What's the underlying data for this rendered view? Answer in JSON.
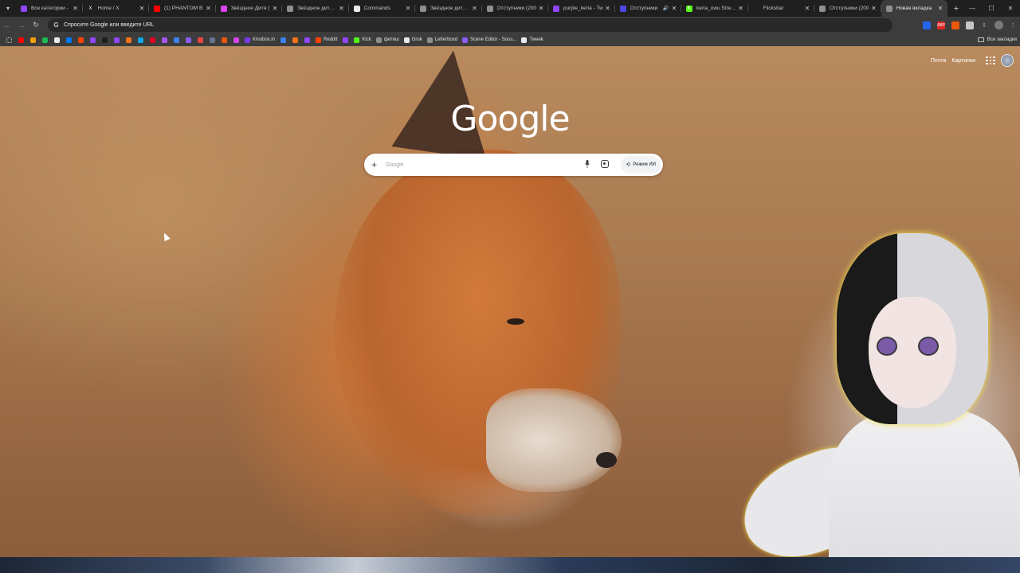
{
  "tabs": [
    {
      "title": "Все категории -",
      "favicon_color": "#9146ff",
      "favicon_icon": "twitch-icon"
    },
    {
      "title": "Home / X",
      "favicon_color": "#1f1f1f",
      "favicon_icon": "x-icon",
      "favicon_glyph": "X"
    },
    {
      "title": "(1) PHANTOM B",
      "favicon_color": "#ff0000",
      "favicon_icon": "youtube-icon"
    },
    {
      "title": "Звёздное Дитя (",
      "favicon_color": "#d946ef",
      "favicon_icon": "anime-site-icon"
    },
    {
      "title": "Звёздное дитя (2",
      "favicon_color": "#8e8e8e",
      "favicon_icon": "globe-icon"
    },
    {
      "title": "Commands",
      "favicon_color": "#e8eaed",
      "favicon_icon": "chat-icon"
    },
    {
      "title": "Звёздное дитя (2",
      "favicon_color": "#8e8e8e",
      "favicon_icon": "globe-icon"
    },
    {
      "title": "Отступники (200",
      "favicon_color": "#8e8e8e",
      "favicon_icon": "globe-icon"
    },
    {
      "title": "purple_keria - Tw",
      "favicon_color": "#9146ff",
      "favicon_icon": "twitch-icon"
    },
    {
      "title": "Отступники",
      "favicon_color": "#4f46e5",
      "favicon_icon": "play-icon",
      "audio": true
    },
    {
      "title": "keria_uwu Stream",
      "favicon_color": "#53fc18",
      "favicon_icon": "kick-icon",
      "favicon_glyph": "K"
    },
    {
      "title": "Flicksbar",
      "favicon_color": "#1f1f1f",
      "favicon_icon": "flicksbar-icon"
    },
    {
      "title": "Отступники (200",
      "favicon_color": "#8e8e8e",
      "favicon_icon": "globe-icon"
    },
    {
      "title": "Новая вкладка",
      "favicon_color": "#8e8e8e",
      "favicon_icon": "globe-icon",
      "active": true
    }
  ],
  "omnibox": {
    "placeholder": "Спросите Google или введите URL"
  },
  "bookmarks": {
    "icon_only": [
      {
        "color": "#ff0000",
        "icon": "youtube-icon"
      },
      {
        "color": "#f59e0b",
        "icon": "bookmark-icon"
      },
      {
        "color": "#1db954",
        "icon": "spotify-icon"
      },
      {
        "color": "#e8eaed",
        "icon": "x-icon"
      },
      {
        "color": "#0077ff",
        "icon": "vk-icon"
      },
      {
        "color": "#ff4500",
        "icon": "bookmark-icon"
      },
      {
        "color": "#9146ff",
        "icon": "twitch-icon"
      },
      {
        "color": "#1f1f1f",
        "icon": "bookmark-icon"
      },
      {
        "color": "#9146ff",
        "icon": "twitch-icon"
      },
      {
        "color": "#f97316",
        "icon": "bookmark-icon"
      },
      {
        "color": "#0ea5e9",
        "icon": "bookmark-icon"
      },
      {
        "color": "#e60023",
        "icon": "pinterest-icon"
      },
      {
        "color": "#a855f7",
        "icon": "bookmark-icon"
      },
      {
        "color": "#3b82f6",
        "icon": "bookmark-icon"
      },
      {
        "color": "#8b5cf6",
        "icon": "bookmark-icon"
      },
      {
        "color": "#ef4444",
        "icon": "bookmark-icon"
      },
      {
        "color": "#64748b",
        "icon": "bookmark-icon"
      },
      {
        "color": "#ea580c",
        "icon": "bookmark-icon"
      },
      {
        "color": "#d946ef",
        "icon": "bookmark-icon"
      }
    ],
    "labeled": [
      {
        "label": "Kinobox.in",
        "color": "#7c3aed",
        "icon": "play-icon"
      },
      {
        "label": "",
        "color": "#3b82f6",
        "icon": "bookmark-icon"
      },
      {
        "label": "",
        "color": "#f97316",
        "icon": "bookmark-icon"
      },
      {
        "label": "",
        "color": "#9146ff",
        "icon": "bookmark-icon"
      },
      {
        "label": "Reddit",
        "color": "#ff4500",
        "icon": "reddit-icon"
      },
      {
        "label": "",
        "color": "#9146ff",
        "icon": "twitch-icon"
      },
      {
        "label": "Kick",
        "color": "#53fc18",
        "icon": "kick-icon"
      },
      {
        "label": "фетиш",
        "color": "#8e8e8e",
        "icon": "globe-icon"
      },
      {
        "label": "Grok",
        "color": "#e8eaed",
        "icon": "grok-icon"
      },
      {
        "label": "Letterboxd",
        "color": "#8e8e8e",
        "icon": "letterboxd-icon"
      },
      {
        "label": "Scene Editor - Sous...",
        "color": "#8b5cf6",
        "icon": "globe-icon"
      },
      {
        "label": "Tweek",
        "color": "#e8eaed",
        "icon": "tweek-icon"
      }
    ],
    "all_label": "Все закладки"
  },
  "ntp": {
    "links": {
      "mail": "Почта",
      "images": "Картинки"
    },
    "logo": "Google",
    "search_placeholder": "Google",
    "ai_mode_label": "Режим ИИ"
  },
  "extensions": [
    {
      "color": "#2563eb",
      "icon": "translate-extension-icon"
    },
    {
      "color": "#dc2626",
      "icon": "adblock-extension-icon",
      "glyph": "ABP"
    },
    {
      "color": "#ea580c",
      "icon": "extension-icon"
    },
    {
      "color": "#c4c7c5",
      "icon": "puzzle-icon"
    }
  ]
}
